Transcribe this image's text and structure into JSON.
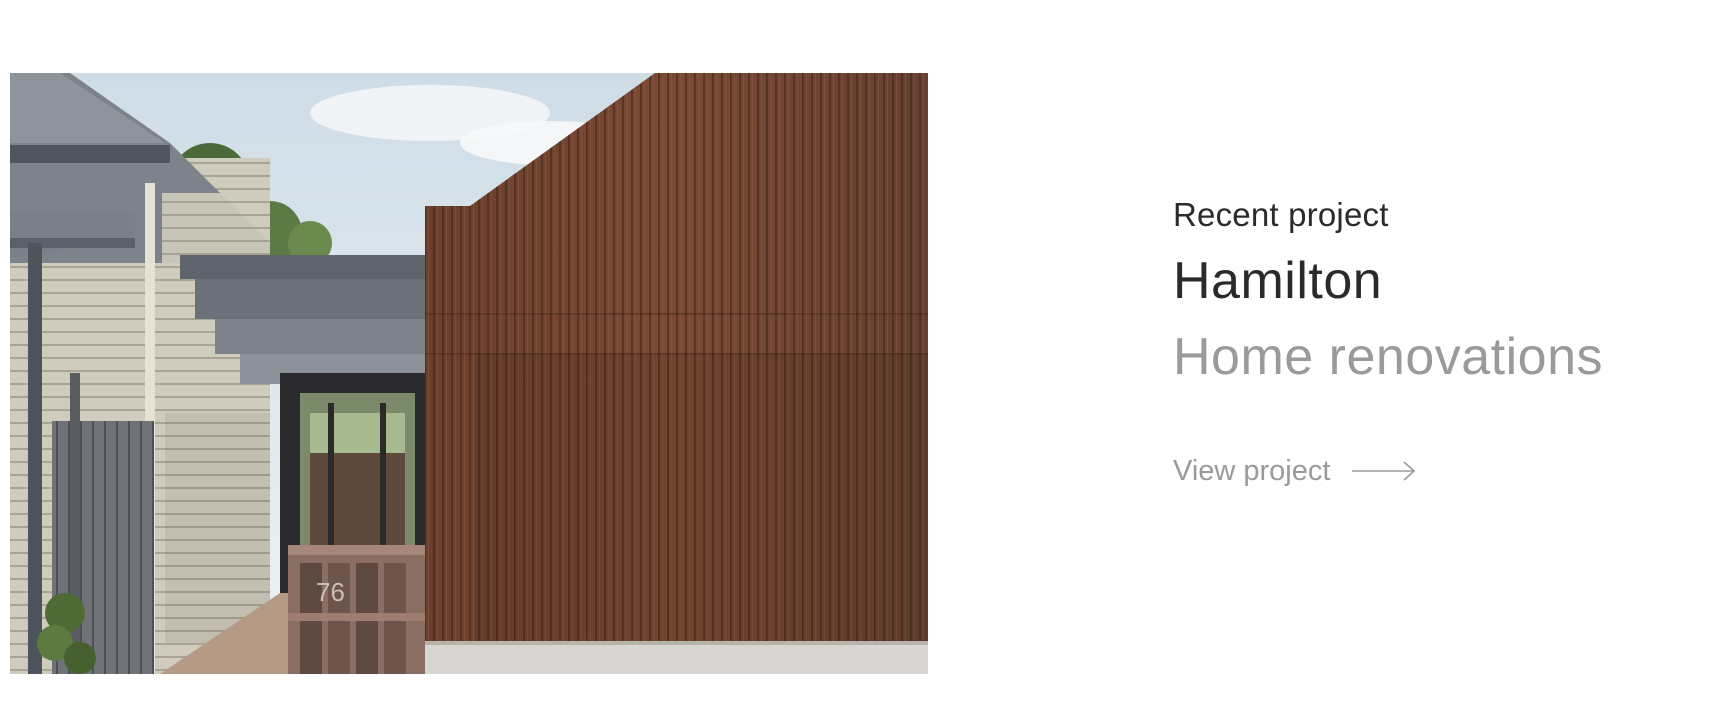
{
  "project": {
    "eyebrow": "Recent project",
    "title": "Hamilton",
    "subtitle": "Home renovations",
    "link_label": "View project"
  },
  "photo": {
    "house_number": "76"
  },
  "icons": {
    "link_arrow": "arrow-right-icon"
  },
  "colors": {
    "heading": "#2a2a2a",
    "muted": "#9a9a9a",
    "timber": "#6e4330"
  }
}
